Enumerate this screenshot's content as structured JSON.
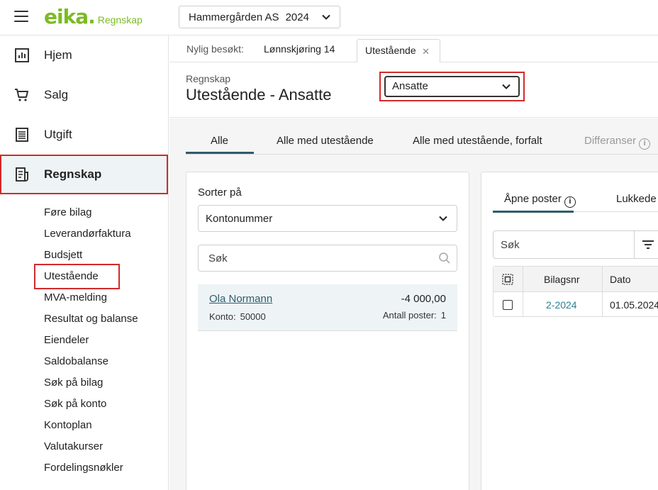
{
  "app": {
    "logo_text": "eika.",
    "logo_subtitle": "Regnskap",
    "company": "Hammergården AS",
    "year": "2024",
    "brand_color": "#7cbb23",
    "accent_color": "#2d5d6d",
    "highlight_color": "#d22a2a"
  },
  "sidebar": {
    "main_items": [
      {
        "label": "Hjem",
        "icon": "bar-chart-icon"
      },
      {
        "label": "Salg",
        "icon": "cart-icon"
      },
      {
        "label": "Utgift",
        "icon": "receipt-icon"
      },
      {
        "label": "Regnskap",
        "icon": "ledger-icon",
        "active": true
      }
    ],
    "sub_items": [
      "Føre bilag",
      "Leverandørfaktura",
      "Budsjett",
      "Utestående",
      "MVA-melding",
      "Resultat og balanse",
      "Eiendeler",
      "Saldobalanse",
      "Søk på bilag",
      "Søk på konto",
      "Kontoplan",
      "Valutakurser",
      "Fordelingsnøkler"
    ],
    "active_sub_item": "Utestående"
  },
  "recent": {
    "label": "Nylig besøkt:",
    "items": [
      "Lønnskjøring 14"
    ],
    "open_tab": "Utestående"
  },
  "header": {
    "breadcrumb": "Regnskap",
    "title": "Utestående - Ansatte",
    "type_selected": "Ansatte"
  },
  "tabs": [
    {
      "label": "Alle",
      "active": true
    },
    {
      "label": "Alle med utestående"
    },
    {
      "label": "Alle med utestående, forfalt"
    },
    {
      "label": "Differanser",
      "disabled": true
    }
  ],
  "left_panel": {
    "sort_label": "Sorter på",
    "sort_value": "Kontonummer",
    "search_placeholder": "Søk",
    "accounts": [
      {
        "name": "Ola Normann",
        "amount": "-4 000,00",
        "account_label": "Konto:",
        "account_number": "50000",
        "count_label": "Antall poster:",
        "count": "1"
      }
    ]
  },
  "right_panel": {
    "tabs": [
      {
        "label": "Åpne poster",
        "active": true
      },
      {
        "label": "Lukkede"
      }
    ],
    "search_placeholder": "Søk",
    "table": {
      "columns": [
        "Bilagsnr",
        "Dato"
      ],
      "rows": [
        {
          "bilagsnr": "2-2024",
          "dato": "01.05.2024"
        }
      ]
    }
  }
}
